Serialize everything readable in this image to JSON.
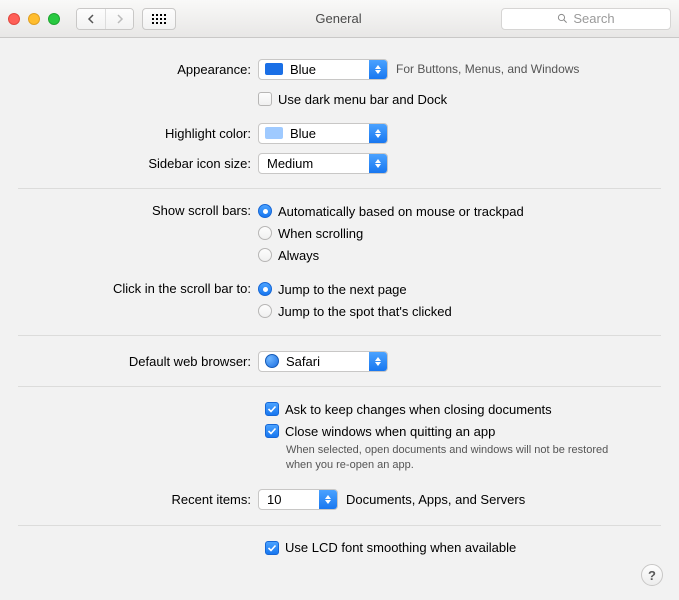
{
  "header": {
    "title": "General",
    "search_placeholder": "Search"
  },
  "appearance": {
    "label": "Appearance:",
    "value": "Blue",
    "swatch_color": "#1a6fe6",
    "note": "For Buttons, Menus, and Windows",
    "dark_mode_label": "Use dark menu bar and Dock",
    "dark_mode_checked": false
  },
  "highlight": {
    "label": "Highlight color:",
    "value": "Blue",
    "swatch_color": "#9fcaff"
  },
  "sidebar_icon": {
    "label": "Sidebar icon size:",
    "value": "Medium"
  },
  "scroll_bars": {
    "label": "Show scroll bars:",
    "options": [
      {
        "label": "Automatically based on mouse or trackpad",
        "selected": true
      },
      {
        "label": "When scrolling",
        "selected": false
      },
      {
        "label": "Always",
        "selected": false
      }
    ]
  },
  "click_scroll": {
    "label": "Click in the scroll bar to:",
    "options": [
      {
        "label": "Jump to the next page",
        "selected": true
      },
      {
        "label": "Jump to the spot that's clicked",
        "selected": false
      }
    ]
  },
  "default_browser": {
    "label": "Default web browser:",
    "value": "Safari"
  },
  "docs": {
    "ask_keep_label": "Ask to keep changes when closing documents",
    "ask_keep_checked": true,
    "close_windows_label": "Close windows when quitting an app",
    "close_windows_checked": true,
    "close_windows_note": "When selected, open documents and windows will not be restored when you re-open an app."
  },
  "recent_items": {
    "label": "Recent items:",
    "value": "10",
    "note": "Documents, Apps, and Servers"
  },
  "font_smoothing": {
    "label": "Use LCD font smoothing when available",
    "checked": true
  },
  "help": {
    "label": "?"
  }
}
